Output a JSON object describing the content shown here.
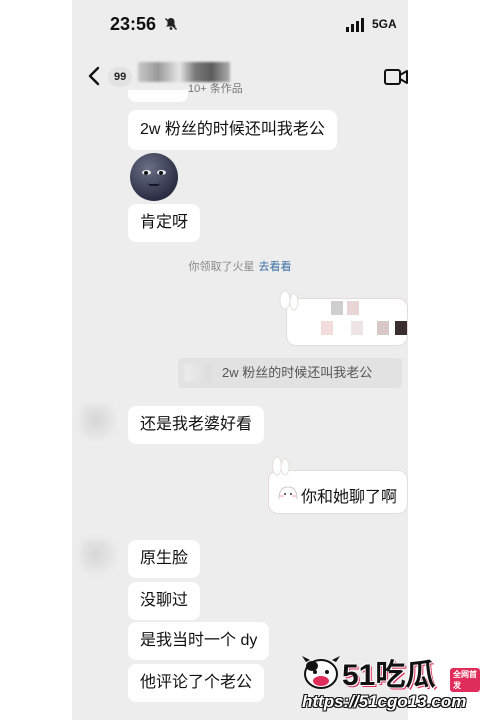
{
  "status_bar": {
    "time": "23:56",
    "network": "5GA"
  },
  "header": {
    "badge": "99",
    "subtitle": "10+ 条作品"
  },
  "messages": [
    {
      "side": "left",
      "text": "2w 粉丝的时候还叫我老公"
    },
    {
      "side": "left",
      "type": "sticker",
      "sticker": "moon-face"
    },
    {
      "side": "left",
      "text": "肯定呀"
    },
    {
      "side": "right",
      "text": "你和她聊了啊"
    },
    {
      "side": "left",
      "text": "还是我老婆好看"
    },
    {
      "side": "left",
      "text": "原生脸"
    },
    {
      "side": "left",
      "text": "没聊过"
    },
    {
      "side": "left",
      "text": "是我当时一个 dy"
    },
    {
      "side": "left",
      "text": "他评论了个老公"
    }
  ],
  "system_notice": {
    "text": "你领取了火星",
    "link": "去看看"
  },
  "quote": {
    "text": "2w 粉丝的时候还叫我老公"
  },
  "watermark": {
    "brand": "51吃瓜",
    "tag": "全网首发",
    "url": "https://51cgo13.com"
  },
  "colors": {
    "chat_background": "#ededed",
    "bubble": "#ffffff",
    "link": "#3a6fa5",
    "brand_accent": "#e02c5a"
  }
}
